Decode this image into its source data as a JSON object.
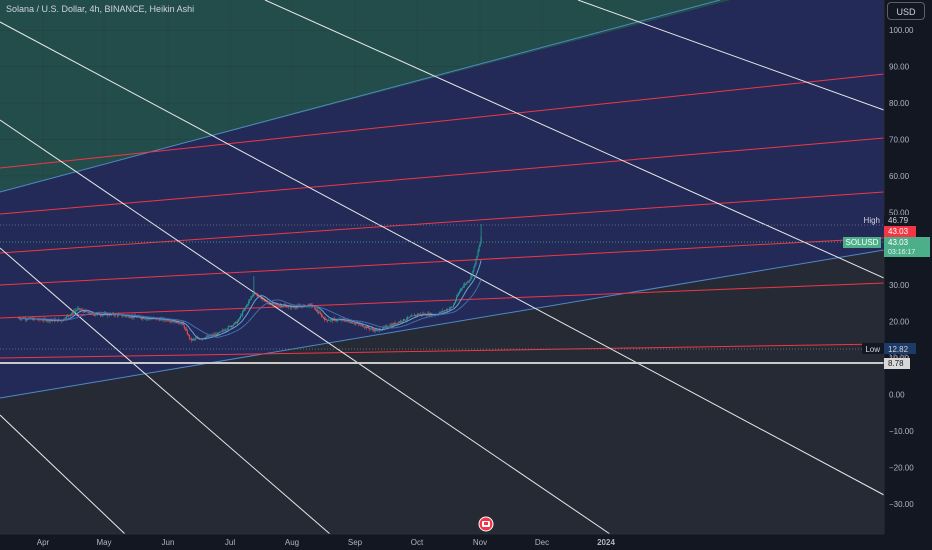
{
  "header": {
    "title": "Solana / U.S. Dollar, 4h, BINANCE, Heikin Ashi",
    "currency_button": "USD"
  },
  "colors": {
    "background": "#131722",
    "grid_line": "#2a2e39",
    "fan_line": "#e8e8e8",
    "channel_line": "#f23645",
    "band_top": "#224d4a",
    "band_mid": "#232a58",
    "band_bottom": "#262a34",
    "diagonal_blue": "#4f88c9",
    "candle_up": "#26a69a",
    "candle_down": "#ef5350",
    "ma_line": "#6a9fd8",
    "price_tag_green": "#4caf8a",
    "price_tag_red": "#f23645"
  },
  "price_axis": {
    "labels": [
      "100.00",
      "90.00",
      "80.00",
      "70.00",
      "60.00",
      "50.00",
      "40.00",
      "30.00",
      "20.00",
      "10.00",
      "0.00",
      "−10.00",
      "−20.00",
      "−30.00"
    ],
    "high_label": "High",
    "high_value": "46.79",
    "current_value": "43.03",
    "symbol_label": "SOLUSD",
    "symbol_value": "43.03",
    "countdown": "03:16:17",
    "low_label": "Low",
    "low_value": "12.82",
    "hidden_level": "10.00",
    "level_value": "8.78"
  },
  "time_axis": {
    "labels": [
      "Apr",
      "May",
      "Jun",
      "Jul",
      "Aug",
      "Sep",
      "Oct",
      "Nov",
      "Dec",
      "2024"
    ],
    "bold_label": "2024"
  },
  "chart_data": {
    "type": "candlestick",
    "symbol": "SOLUSD",
    "interval": "4h",
    "exchange": "BINANCE",
    "style": "Heikin Ashi",
    "x_labels": [
      "Apr",
      "May",
      "Jun",
      "Jul",
      "Aug",
      "Sep",
      "Oct",
      "Nov",
      "Dec",
      "2024"
    ],
    "y_range": [
      -35,
      114
    ],
    "price_path": [
      {
        "t": "2023-03-20",
        "p": 21.0
      },
      {
        "t": "2023-04-01",
        "p": 20.5
      },
      {
        "t": "2023-04-10",
        "p": 20.3
      },
      {
        "t": "2023-04-18",
        "p": 23.5
      },
      {
        "t": "2023-04-25",
        "p": 22.0
      },
      {
        "t": "2023-05-05",
        "p": 22.0
      },
      {
        "t": "2023-05-20",
        "p": 21.0
      },
      {
        "t": "2023-06-01",
        "p": 20.5
      },
      {
        "t": "2023-06-08",
        "p": 19.5
      },
      {
        "t": "2023-06-12",
        "p": 15.0
      },
      {
        "t": "2023-06-18",
        "p": 15.5
      },
      {
        "t": "2023-06-25",
        "p": 16.5
      },
      {
        "t": "2023-07-05",
        "p": 20.0
      },
      {
        "t": "2023-07-13",
        "p": 28.0
      },
      {
        "t": "2023-07-20",
        "p": 25.0
      },
      {
        "t": "2023-08-01",
        "p": 24.0
      },
      {
        "t": "2023-08-10",
        "p": 24.5
      },
      {
        "t": "2023-08-17",
        "p": 20.5
      },
      {
        "t": "2023-08-25",
        "p": 20.5
      },
      {
        "t": "2023-09-01",
        "p": 19.5
      },
      {
        "t": "2023-09-11",
        "p": 17.5
      },
      {
        "t": "2023-09-20",
        "p": 19.5
      },
      {
        "t": "2023-10-01",
        "p": 22.0
      },
      {
        "t": "2023-10-10",
        "p": 22.0
      },
      {
        "t": "2023-10-18",
        "p": 24.0
      },
      {
        "t": "2023-10-22",
        "p": 29.0
      },
      {
        "t": "2023-10-27",
        "p": 32.0
      },
      {
        "t": "2023-10-30",
        "p": 38.0
      },
      {
        "t": "2023-11-01",
        "p": 43.0
      }
    ],
    "high": 46.79,
    "low": 12.82,
    "last": 43.03,
    "horizontal_level": 8.78
  }
}
